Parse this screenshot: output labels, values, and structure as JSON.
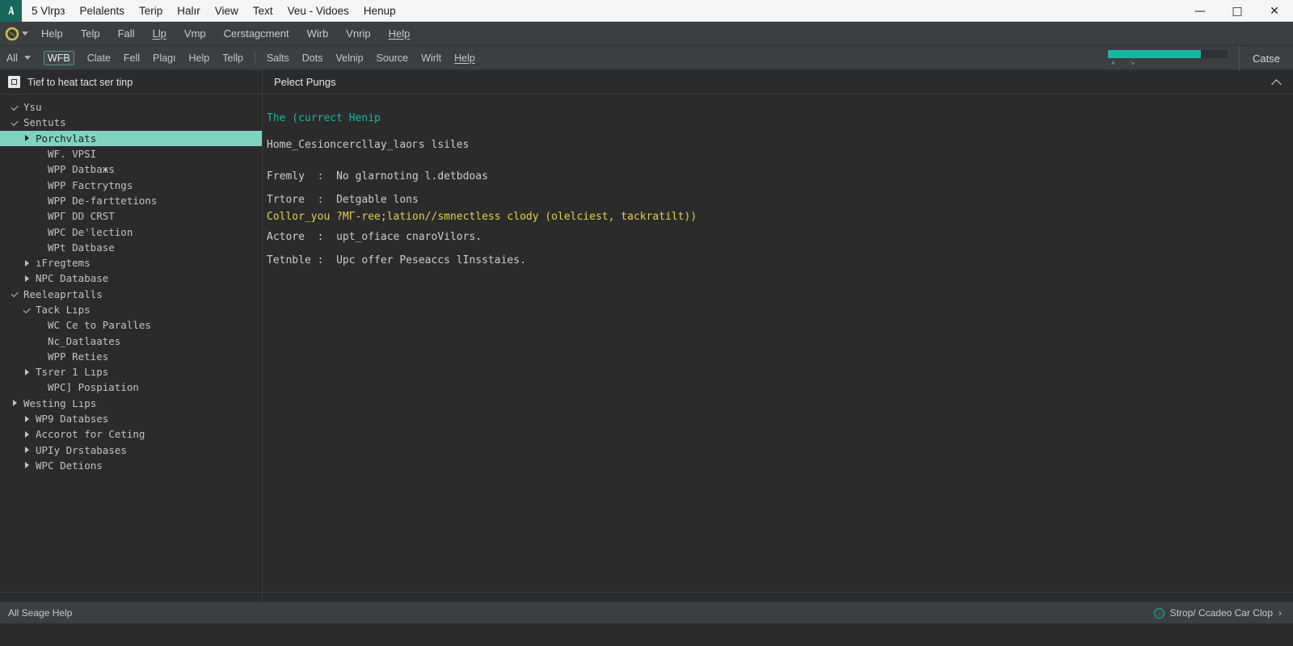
{
  "titlebar": {
    "app_icon": "app-logo-icon",
    "menu": [
      "5 Vlrpз",
      "Pelalents",
      "Terip",
      "Halır",
      "View",
      "Text",
      "Veu - Vidoes",
      "Henup"
    ],
    "window_controls": {
      "minimize": "—",
      "maximize": "□",
      "close": "✕"
    }
  },
  "menubar": {
    "logo_icon": "circle-logo-icon",
    "dropdown_icon": "chevron-down-icon",
    "items": [
      {
        "label": "Help",
        "mnemonic": false
      },
      {
        "label": "Telp",
        "mnemonic": false
      },
      {
        "label": "Fall",
        "mnemonic": false
      },
      {
        "label": "Llp",
        "mnemonic": true
      },
      {
        "label": "Vmp",
        "mnemonic": false
      },
      {
        "label": "Cerstagcment",
        "mnemonic": false
      },
      {
        "label": "Wirb",
        "mnemonic": false
      },
      {
        "label": "Vnrip",
        "mnemonic": false
      },
      {
        "label": "Help",
        "mnemonic": true
      }
    ]
  },
  "toolbar": {
    "scope_label": "All",
    "scope_dropdown_icon": "chevron-down-icon",
    "left_items": [
      {
        "label": "WFB",
        "active": true,
        "mnemonic": false
      },
      {
        "label": "Clate",
        "active": false,
        "mnemonic": false
      },
      {
        "label": "Fell",
        "active": false,
        "mnemonic": false
      },
      {
        "label": "Plagı",
        "active": false,
        "mnemonic": false
      },
      {
        "label": "Help",
        "active": false,
        "mnemonic": false
      },
      {
        "label": "Tellp",
        "active": false,
        "mnemonic": false
      }
    ],
    "right_items": [
      {
        "label": "Salts",
        "active": false,
        "mnemonic": false
      },
      {
        "label": "Dots",
        "active": false,
        "mnemonic": false
      },
      {
        "label": "Velnip",
        "active": false,
        "mnemonic": false
      },
      {
        "label": "Source",
        "active": false,
        "mnemonic": false
      },
      {
        "label": "Wirlt",
        "active": false,
        "mnemonic": false
      },
      {
        "label": "Help",
        "active": false,
        "mnemonic": true
      }
    ],
    "progress": {
      "percent": 78,
      "sub_left": "ᴀ",
      "sub_right": "↘",
      "color": "#19b5a0"
    },
    "far_right_label": "Catse"
  },
  "sidebar": {
    "header_icon": "panel-square-icon",
    "header_title": "Tief to heat tact ser tinp",
    "tree": [
      {
        "label": "Ysu",
        "indent": 0,
        "arrow": "down",
        "selected": false
      },
      {
        "label": "Sentuts",
        "indent": 0,
        "arrow": "down",
        "selected": false
      },
      {
        "label": "Porchvlats",
        "indent": 1,
        "arrow": "right",
        "selected": true
      },
      {
        "label": "WF. VPSI",
        "indent": 2,
        "arrow": "blank",
        "selected": false
      },
      {
        "label": "WPP Datbaжs",
        "indent": 2,
        "arrow": "blank",
        "selected": false
      },
      {
        "label": "WPP Factrytngs",
        "indent": 2,
        "arrow": "blank",
        "selected": false
      },
      {
        "label": "WPP De-farttetions",
        "indent": 2,
        "arrow": "blank",
        "selected": false
      },
      {
        "label": "WPГ DD CRST",
        "indent": 2,
        "arrow": "blank",
        "selected": false
      },
      {
        "label": "WPC De'lection",
        "indent": 2,
        "arrow": "blank",
        "selected": false
      },
      {
        "label": "WPt Datbase",
        "indent": 2,
        "arrow": "blank",
        "selected": false
      },
      {
        "label": "ıFregtems",
        "indent": 1,
        "arrow": "right",
        "selected": false
      },
      {
        "label": "NPC Database",
        "indent": 1,
        "arrow": "right",
        "selected": false
      },
      {
        "label": "Reeleaprtalls",
        "indent": 0,
        "arrow": "down",
        "selected": false
      },
      {
        "label": "Tack Lıps",
        "indent": 1,
        "arrow": "down",
        "selected": false
      },
      {
        "label": "WC Ce to Paralles",
        "indent": 2,
        "arrow": "blank",
        "selected": false
      },
      {
        "label": "Nc_Datlaates",
        "indent": 2,
        "arrow": "blank",
        "selected": false
      },
      {
        "label": "WPP Reties",
        "indent": 2,
        "arrow": "blank",
        "selected": false
      },
      {
        "label": "Tsrer 1 Lıps",
        "indent": 1,
        "arrow": "right",
        "selected": false
      },
      {
        "label": "WPC] Pospiation",
        "indent": 2,
        "arrow": "blank",
        "selected": false
      },
      {
        "label": "Westing Lıps",
        "indent": 0,
        "arrow": "right",
        "selected": false
      },
      {
        "label": "WP9 Databses",
        "indent": 1,
        "arrow": "right",
        "selected": false
      },
      {
        "label": "Accorot for Ceting",
        "indent": 1,
        "arrow": "right",
        "selected": false
      },
      {
        "label": "UPIy Drstabases",
        "indent": 1,
        "arrow": "right",
        "selected": false
      },
      {
        "label": "WPC Detions",
        "indent": 1,
        "arrow": "right",
        "selected": false
      }
    ]
  },
  "main": {
    "header_title": "Pelect Pungs",
    "collapse_icon": "chevron-up-icon",
    "heading": "The (currect Henip",
    "path": "Home_Cesioncerсllay_laoгs lsiles",
    "rows": [
      {
        "text": "Fremly  :  No glarnoting l.detbdoas",
        "style": "normal"
      },
      {
        "text": "Trtore  :  Detgable lons",
        "style": "normal"
      },
      {
        "text": "Collor_you ?MГ-ree;lation//smnectless clody (olelciest, tackratilt))",
        "style": "warn"
      },
      {
        "text": "Actore  :  upt_ofiace cnaroVilors.",
        "style": "normal"
      },
      {
        "text": "Tetnble :  Upc offer Peseaccs lInsstaies.",
        "style": "normal"
      }
    ]
  },
  "statusbar": {
    "left_text": "All  Seage Help",
    "badge_icon": "info-circle-icon",
    "badge_glyph": "ⓘ",
    "right_text": "Strop/ Ccadeo Car Clop",
    "chevron_icon": "chevron-right-icon",
    "chevron_glyph": "›"
  },
  "colors": {
    "accent": "#19b5a0",
    "selection": "#7fd4c1",
    "warn": "#e3d14a",
    "panel_bg": "#2b2b2b",
    "chrome_bg": "#3c3f41"
  }
}
